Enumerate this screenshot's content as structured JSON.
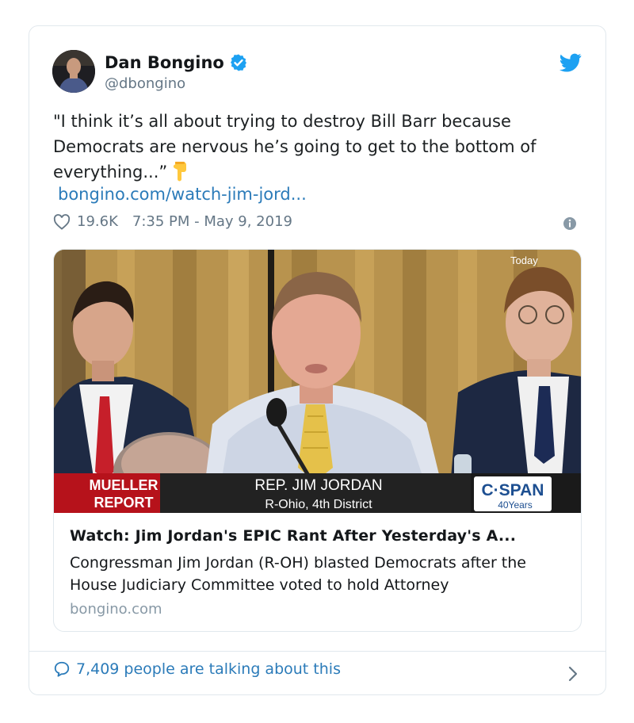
{
  "author": {
    "name": "Dan Bongino",
    "handle": "@dbongino"
  },
  "tweet": {
    "text": "\"I think it’s all about trying to destroy Bill Barr because Democrats are nervous he’s going to get to the bottom of everything...”",
    "link": "bongino.com/watch-jim-jord...",
    "likes": "19.6K",
    "timestamp": "7:35 PM - May 9, 2019"
  },
  "media": {
    "overlay_corner": "Today",
    "lower_third": {
      "tag_line1": "MUELLER",
      "tag_line2": "REPORT",
      "name": "REP. JIM JORDAN",
      "subtitle": "R-Ohio, 4th District",
      "network": "C·SPAN",
      "network_sub": "40Years"
    },
    "title": "Watch: Jim Jordan's EPIC Rant After Yesterday's A...",
    "description": "Congressman Jim Jordan (R-OH) blasted Democrats after the House Judiciary Committee voted to hold Attorney",
    "domain": "bongino.com"
  },
  "footer": {
    "talking": "7,409 people are talking about this"
  },
  "colors": {
    "link": "#2b7bb9",
    "verified": "#1da1f2",
    "muted": "#657786",
    "border": "#e1e8ed"
  },
  "icons": [
    "verified-icon",
    "twitter-bird-icon",
    "heart-icon",
    "info-icon",
    "comment-icon",
    "chevron-right-icon",
    "pointing-down-emoji"
  ]
}
